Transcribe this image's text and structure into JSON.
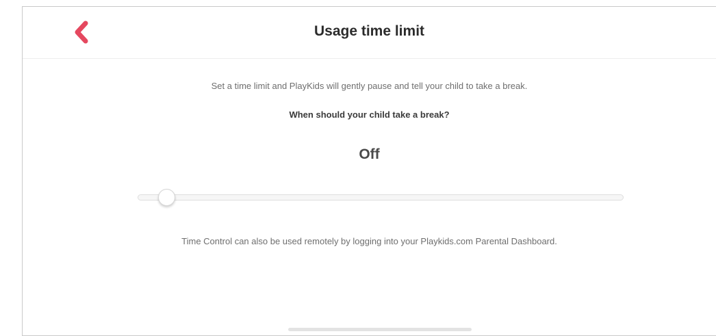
{
  "header": {
    "back_icon": "chevron-left-icon",
    "title": "Usage time limit"
  },
  "main": {
    "intro_text": "Set a time limit and PlayKids will gently pause and tell your child to take a break.",
    "question": "When should your child take a break?",
    "current_value": "Off",
    "slider_level": 0,
    "footer_note": "Time Control can also be used remotely by logging into your Playkids.com Parental Dashboard."
  },
  "colors": {
    "accent": "#e5485f",
    "title_text": "#2b2b2b",
    "body_text": "#6e6e6e"
  }
}
